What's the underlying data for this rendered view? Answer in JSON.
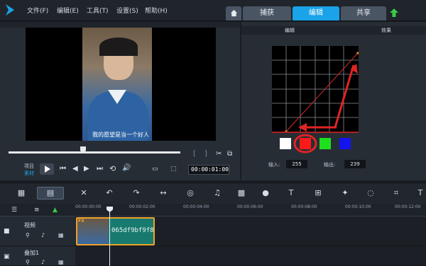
{
  "menu": {
    "file": "文件(F)",
    "edit": "编辑(E)",
    "tools": "工具(T)",
    "settings": "设置(S)",
    "help": "帮助(H)"
  },
  "tabs": {
    "capture": "捕获",
    "edit": "编辑",
    "share": "共享"
  },
  "preview": {
    "subtitle": "我的愿望是当一个好人",
    "project_label": "项目",
    "clip_label": "素材",
    "timecode": "00:00:01:00"
  },
  "curves_panel": {
    "tab_edit": "编辑",
    "tab_effect": "效果",
    "input_label": "输入:",
    "input_value": "255",
    "output_label": "输出:",
    "output_value": "239",
    "swatches": [
      "white",
      "red",
      "green",
      "blue"
    ],
    "selected_swatch": "red"
  },
  "timeline": {
    "ruler_ticks": [
      "00:00:00:00",
      "00:00:02:00",
      "00:00:04:00",
      "00:00:06:00",
      "00:00:08:00",
      "00:00:10:00",
      "00:00:12:00"
    ],
    "track_video": "视频",
    "track_overlay": "叠加1",
    "clip_name": "065df9bf9f8",
    "clip_badge": "FX"
  },
  "colors": {
    "accent": "#1aa3e8",
    "clip": "#187a6e",
    "clip_border": "#f0a22a",
    "annotation": "#e02424"
  }
}
